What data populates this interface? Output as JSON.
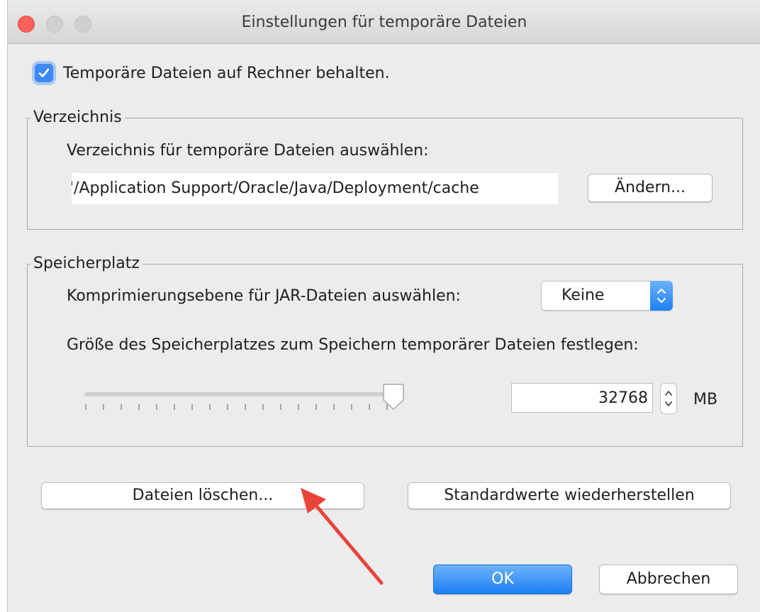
{
  "window": {
    "title": "Einstellungen für temporäre Dateien"
  },
  "keep_temp_files": {
    "checked": true,
    "label": "Temporäre Dateien auf Rechner behalten."
  },
  "directory_group": {
    "title": "Verzeichnis",
    "prompt": "Verzeichnis für temporäre Dateien auswählen:",
    "path_value": "'/Application Support/Oracle/Java/Deployment/cache",
    "change_button": "Ändern..."
  },
  "storage_group": {
    "title": "Speicherplatz",
    "compression_label": "Komprimierungsebene für JAR-Dateien auswählen:",
    "compression_value": "Keine",
    "size_label": "Größe des Speicherplatzes zum Speichern temporärer Dateien festlegen:",
    "size_value": "32768",
    "size_unit": "MB",
    "slider_level": 1.0
  },
  "actions": {
    "delete_files": "Dateien löschen...",
    "restore_defaults": "Standardwerte wiederherstellen",
    "ok": "OK",
    "cancel": "Abbrechen"
  },
  "colors": {
    "accent": "#1d7ff5",
    "annotation_arrow": "#e8443a"
  },
  "icons": {
    "checkbox": "checkmark-icon",
    "select_arrow": "chevron-updown-icon",
    "spinner": "stepper-icon",
    "annotation": "red-arrow-icon"
  }
}
